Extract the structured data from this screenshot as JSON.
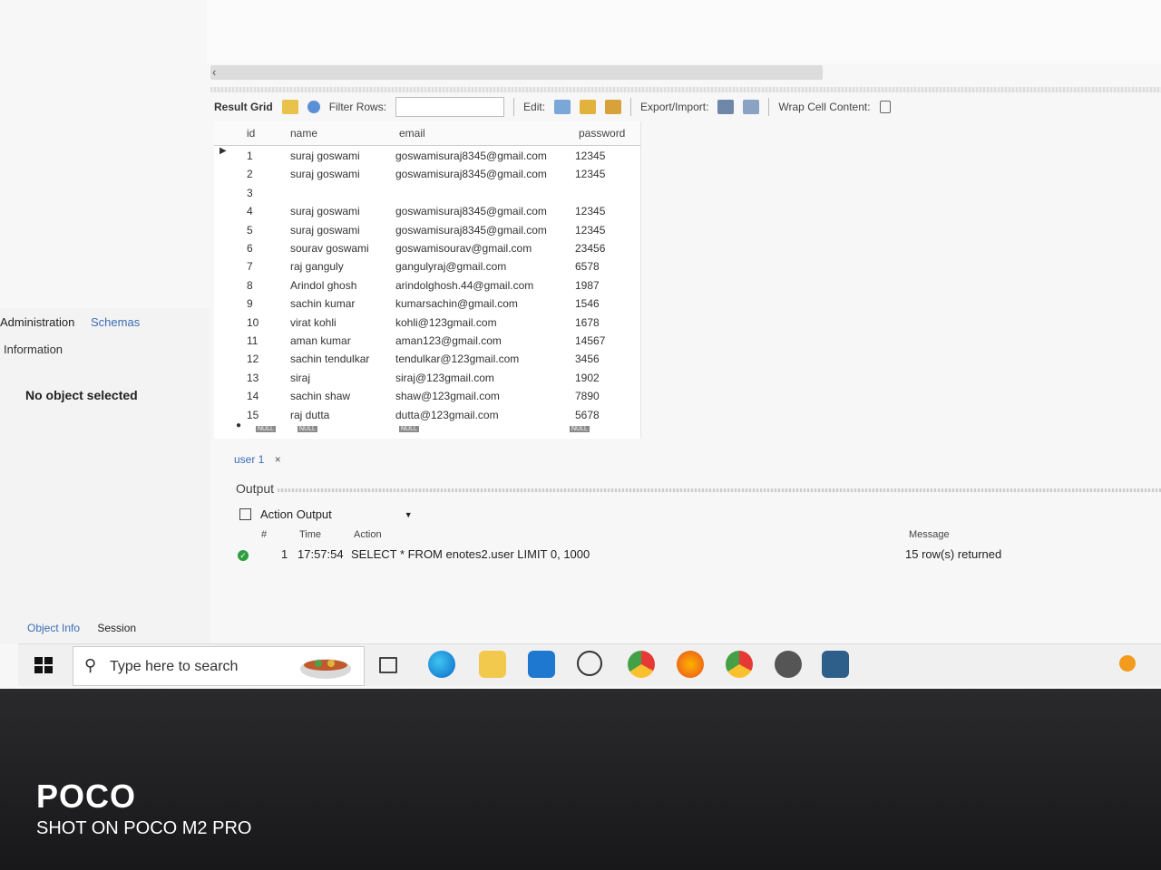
{
  "toolbar": {
    "result_grid": "Result Grid",
    "filter_rows": "Filter Rows:",
    "edit": "Edit:",
    "export_import": "Export/Import:",
    "wrap_cell": "Wrap Cell Content:"
  },
  "grid": {
    "columns": [
      "id",
      "name",
      "email",
      "password"
    ],
    "rows": [
      {
        "id": "1",
        "name": "suraj goswami",
        "email": "goswamisuraj8345@gmail.com",
        "password": "12345"
      },
      {
        "id": "2",
        "name": "suraj goswami",
        "email": "goswamisuraj8345@gmail.com",
        "password": "12345"
      },
      {
        "id": "3",
        "name": "",
        "email": "",
        "password": ""
      },
      {
        "id": "4",
        "name": "suraj goswami",
        "email": "goswamisuraj8345@gmail.com",
        "password": "12345"
      },
      {
        "id": "5",
        "name": "suraj goswami",
        "email": "goswamisuraj8345@gmail.com",
        "password": "12345"
      },
      {
        "id": "6",
        "name": "sourav goswami",
        "email": "goswamisourav@gmail.com",
        "password": "23456"
      },
      {
        "id": "7",
        "name": "raj ganguly",
        "email": "gangulyraj@gmail.com",
        "password": "6578"
      },
      {
        "id": "8",
        "name": "Arindol ghosh",
        "email": "arindolghosh.44@gmail.com",
        "password": "1987"
      },
      {
        "id": "9",
        "name": "sachin kumar",
        "email": "kumarsachin@gmail.com",
        "password": "1546"
      },
      {
        "id": "10",
        "name": "virat kohli",
        "email": "kohli@123gmail.com",
        "password": "1678"
      },
      {
        "id": "11",
        "name": "aman kumar",
        "email": "aman123@gmail.com",
        "password": "14567"
      },
      {
        "id": "12",
        "name": "sachin tendulkar",
        "email": "tendulkar@123gmail.com",
        "password": "3456"
      },
      {
        "id": "13",
        "name": "siraj",
        "email": "siraj@123gmail.com",
        "password": "1902"
      },
      {
        "id": "14",
        "name": "sachin shaw",
        "email": "shaw@123gmail.com",
        "password": "7890"
      },
      {
        "id": "15",
        "name": "raj dutta",
        "email": "dutta@123gmail.com",
        "password": "5678"
      }
    ],
    "null_label": "NULL"
  },
  "left": {
    "tab_admin": "Administration",
    "tab_schemas": "Schemas",
    "info_header": "Information",
    "no_object": "No object selected",
    "tab_object_info": "Object Info",
    "tab_session": "Session"
  },
  "result_tab": "user 1",
  "output": {
    "label": "Output",
    "action_output": "Action Output",
    "headers": {
      "num": "#",
      "time": "Time",
      "action": "Action",
      "message": "Message"
    },
    "row": {
      "num": "1",
      "time": "17:57:54",
      "action": "SELECT * FROM enotes2.user LIMIT 0, 1000",
      "message": "15 row(s) returned"
    }
  },
  "taskbar": {
    "search_placeholder": "Type here to search"
  },
  "watermark": {
    "brand": "POCO",
    "caption": "SHOT ON POCO M2 PRO"
  }
}
